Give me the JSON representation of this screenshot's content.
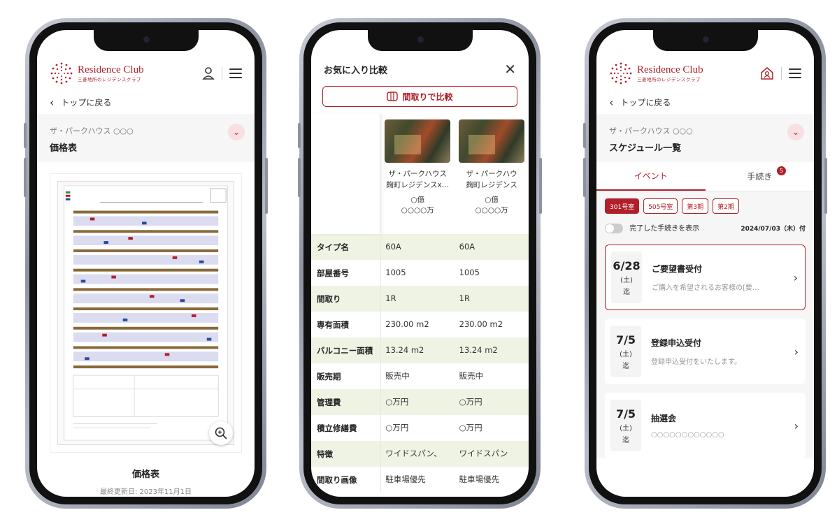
{
  "brand": {
    "name_en": "Residence Club",
    "name_jp": "三菱地所のレジデンスクラブ",
    "accent": "#b0202a"
  },
  "screen1": {
    "back_label": "トップに戻る",
    "property_name": "ザ・パークハウス ○○○",
    "page_title": "価格表",
    "caption": "価格表",
    "updated": "最終更新日: 2023年11月1日",
    "icons": [
      "user-icon",
      "hamburger-icon",
      "chevron-left-icon",
      "chevron-down-icon",
      "zoom-in-icon"
    ]
  },
  "screen2": {
    "title": "お気に入り比較",
    "compare_button": "間取りで比較",
    "units": [
      {
        "name_line1": "ザ・パークハウス",
        "name_line2": "麹町レジデンスx…",
        "price_line1": "○億",
        "price_line2": "○○○○万"
      },
      {
        "name_line1": "ザ・パークハウ",
        "name_line2": "麹町レジデンス",
        "price_line1": "○億",
        "price_line2": "○○○○万"
      }
    ],
    "rows": [
      {
        "label": "タイプ名",
        "v1": "60A",
        "v2": "60A"
      },
      {
        "label": "部屋番号",
        "v1": "1005",
        "v2": "1005"
      },
      {
        "label": "間取り",
        "v1": "1R",
        "v2": "1R"
      },
      {
        "label": "専有面積",
        "v1": "230.00 m2",
        "v2": "230.00 m2"
      },
      {
        "label": "バルコニー面積",
        "v1": "13.24 m2",
        "v2": "13.24 m2"
      },
      {
        "label": "販売期",
        "v1": "販売中",
        "v2": "販売中"
      },
      {
        "label": "管理費",
        "v1": "○万円",
        "v2": "○万円"
      },
      {
        "label": "積立修繕費",
        "v1": "○万円",
        "v2": "○万円"
      },
      {
        "label": "特徴",
        "v1": "ワイドスパン、",
        "v2": "ワイドスパン"
      },
      {
        "label": "間取り画像",
        "v1": "駐車場優先",
        "v2": "駐車場優先"
      }
    ]
  },
  "screen3": {
    "back_label": "トップに戻る",
    "property_name": "ザ・パークハウス ○○○",
    "page_title": "スケジュール一覧",
    "tabs": [
      "イベント",
      "手続き"
    ],
    "badge_count": "5",
    "chips": [
      "301号室",
      "505号室",
      "第3期",
      "第2期"
    ],
    "toggle_label": "完了した手続きを表示",
    "date_note": "2024/07/03（木）付",
    "events": [
      {
        "date": "6/28",
        "weekday": "(土)",
        "suffix": "迄",
        "title": "ご要望書受付",
        "desc": "ご購入を希望されるお客様の[要…"
      },
      {
        "date": "7/5",
        "weekday": "(土)",
        "suffix": "迄",
        "title": "登録申込受付",
        "desc": "登録申込受付をいたします。"
      },
      {
        "date": "7/5",
        "weekday": "(土)",
        "suffix": "迄",
        "title": "抽選会",
        "desc": "○○○○○○○○○○○○"
      }
    ]
  }
}
